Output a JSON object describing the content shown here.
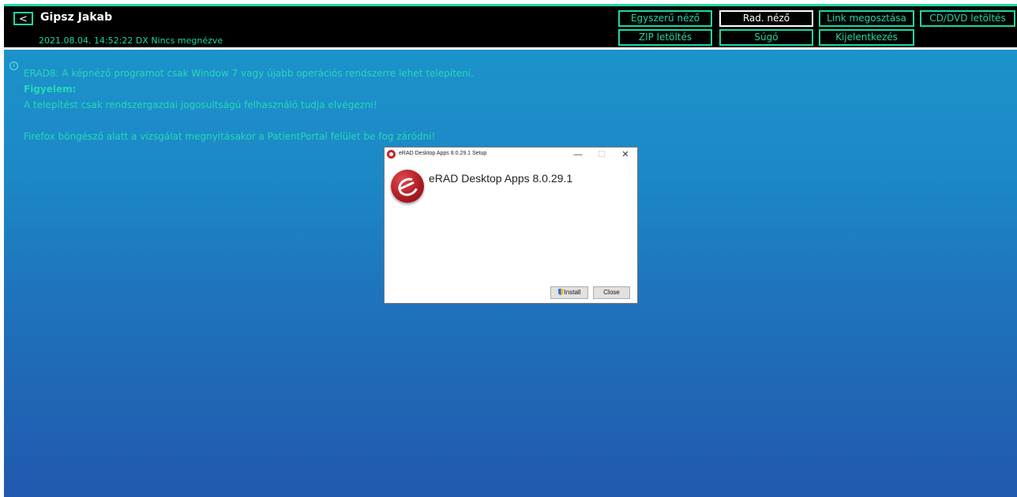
{
  "header": {
    "back_label": "<",
    "patient_name": "Gipsz Jakab",
    "study_info": "2021.08.04. 14:52:22 DX Nincs megnézve",
    "nav": {
      "simple_viewer": "Egyszerű néző",
      "rad_viewer": "Rad. néző",
      "share_link": "Link megosztása",
      "cd_dvd_download": "CD/DVD letöltés",
      "zip_download": "ZIP letöltés",
      "help": "Súgó",
      "logout": "Kijelentkezés"
    }
  },
  "notice": {
    "icon": "info-icon",
    "line1": "ERAD8: A képnéző programot csak Window 7 vagy újabb operációs rendszerre lehet telepíteni.",
    "line2": "Figyelem:",
    "line3": "A telepítést csak rendszergazdai jogosultságú felhasználó tudja elvégezni!",
    "line4": "Firefox böngésző alatt a vizsgálat megnyitásakor a PatientPortal felület be fog záródni!"
  },
  "dialog": {
    "title": "eRAD Desktop Apps 8.0.29.1 Setup",
    "heading": "eRAD Desktop Apps 8.0.29.1",
    "minimize": "—",
    "maximize": "☐",
    "close_x": "✕",
    "install_label": "Install",
    "close_label": "Close"
  },
  "colors": {
    "accent": "#1ed7a6",
    "header_bg": "#000000",
    "page_top": "#1b96cc",
    "page_bottom": "#2159ae"
  }
}
